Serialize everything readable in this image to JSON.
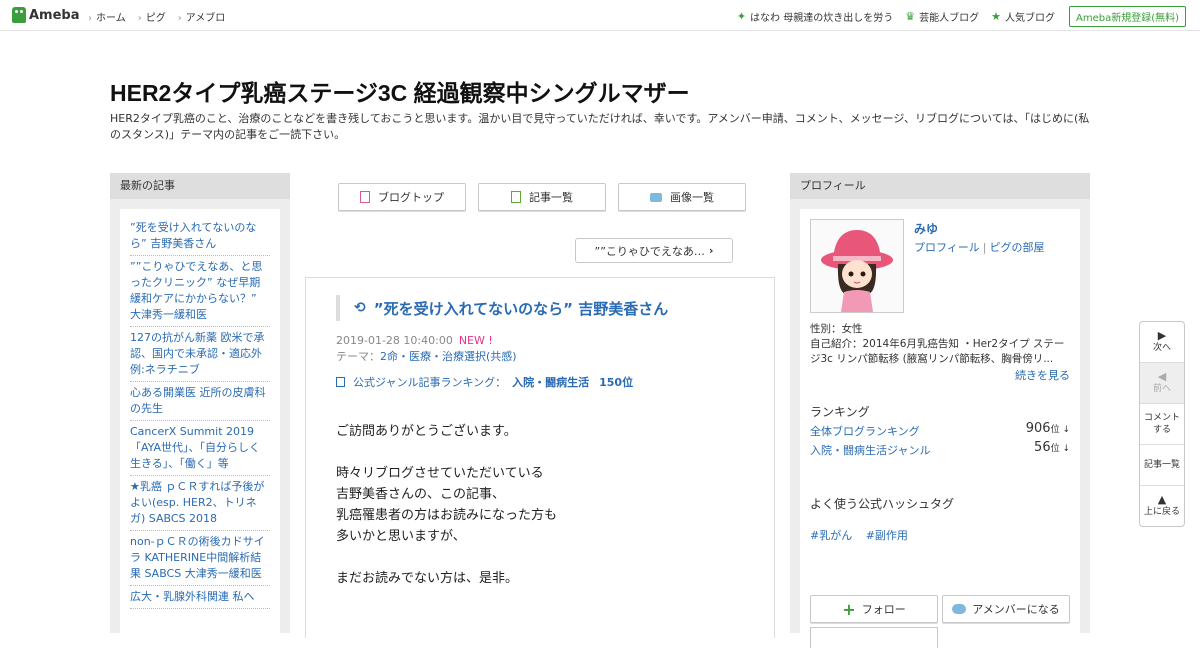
{
  "topbar": {
    "logo": "Ameba",
    "nav": [
      "ホーム",
      "ピグ",
      "アメブロ"
    ],
    "right": [
      {
        "icon": "sparkle-icon",
        "label": "はなわ 母親達の炊き出しを労う"
      },
      {
        "icon": "crown-icon",
        "label": "芸能人ブログ"
      },
      {
        "icon": "crown-icon",
        "label": "人気ブログ"
      }
    ],
    "register": "Ameba新規登録(無料)"
  },
  "header": {
    "title": "HER2タイプ乳癌ステージ3C 経過観察中シングルマザー",
    "description": "HER2タイプ乳癌のこと、治療のことなどを書き残しておこうと思います。温かい目で見守っていただければ、幸いです。アメンバー申請、コメント、メッセージ、リブログについては、「はじめに(私のスタンス)」テーマ内の記事をご一読下さい。"
  },
  "left": {
    "heading": "最新の記事",
    "items": [
      "”死を受け入れてないのなら” 吉野美香さん",
      "””こりゃひでえなあ、と思ったクリニック” なぜ早期緩和ケアにかからない？” 大津秀一緩和医",
      "127の抗がん新薬 欧米で承認、国内で未承認・適応外 例:ネラチニブ",
      "心ある開業医 近所の皮膚科の先生",
      "CancerX Summit 2019 「AYA世代」、「自分らしく生きる」、「働く」等",
      "★乳癌 ｐＣＲすれば予後がよい(esp. HER2、トリネガ) SABCS 2018",
      "non-ｐＣＲの術後カドサイラ KATHERINE中間解析結果 SABCS 大津秀一緩和医",
      "広大・乳腺外科関連 私へ"
    ]
  },
  "main": {
    "buttons": {
      "top": "ブログトップ",
      "list": "記事一覧",
      "images": "画像一覧"
    },
    "prev": "””こりゃひでえなあ…",
    "article": {
      "title": "”死を受け入れてないのなら” 吉野美香さん",
      "date": "2019-01-28 10:40:00",
      "new": "NEW !",
      "theme_label": "テーマ：",
      "theme": "2命・医療・治療選択(共感)",
      "ranking_label": "公式ジャンル記事ランキング：",
      "ranking_genre": "入院・闘病生活",
      "ranking_rank": "150位",
      "paragraphs": [
        [
          "ご訪問ありがとうございます。"
        ],
        [
          "時々リブログさせていただいている",
          "吉野美香さんの、この記事、",
          "乳癌罹患者の方はお読みになった方も",
          "多いかと思いますが、"
        ],
        [
          "まだお読みでない方は、是非。"
        ]
      ]
    }
  },
  "right": {
    "heading": "プロフィール",
    "name": "みゆ",
    "link1": "プロフィール",
    "link2": "ピグの部屋",
    "gender": "性別：女性",
    "intro": "自己紹介：2014年6月乳癌告知 ・Her2タイプ ステージ3c リンパ節転移 (腋窩リンパ節転移、胸骨傍リ...",
    "more": "続きを見る",
    "ranking_heading": "ランキング",
    "rankings": [
      {
        "label": "全体ブログランキング",
        "value": "906",
        "unit": "位 ↓"
      },
      {
        "label": "入院・闘病生活ジャンル",
        "value": "56",
        "unit": "位 ↓"
      }
    ],
    "tags_heading": "よく使う公式ハッシュタグ",
    "tags": [
      "#乳がん",
      "#副作用"
    ],
    "follow": "フォロー",
    "amember": "アメンバーになる"
  },
  "sidenav": {
    "next": "次へ",
    "prev": "前へ",
    "comment": "コメントする",
    "list": "記事一覧",
    "top": "上に戻る"
  }
}
